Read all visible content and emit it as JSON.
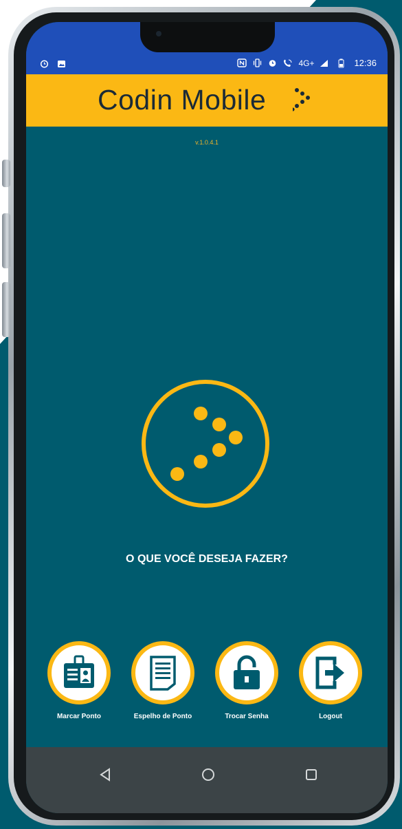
{
  "app": {
    "title": "Codin Mobile",
    "version": "v.1.0.4.1",
    "brand_colors": {
      "accent": "#fbb814",
      "background": "#005b6e",
      "status_bar": "#1f4fb9"
    }
  },
  "status_bar": {
    "left_icons": [
      "alarm-icon",
      "image-icon"
    ],
    "right_icons": [
      "nfc-icon",
      "vibrate-icon",
      "alarm-icon",
      "wifi-call-icon"
    ],
    "network": "4G+",
    "time": "12:36"
  },
  "main": {
    "question": "O QUE VOCÊ DESEJA FAZER?"
  },
  "actions": [
    {
      "label": "Marcar Ponto",
      "icon": "id-badge-icon"
    },
    {
      "label": "Espelho de Ponto",
      "icon": "document-icon"
    },
    {
      "label": "Trocar Senha",
      "icon": "padlock-icon"
    },
    {
      "label": "Logout",
      "icon": "logout-icon"
    }
  ],
  "navigation": {
    "buttons": [
      "back-icon",
      "home-icon",
      "recents-icon"
    ]
  }
}
